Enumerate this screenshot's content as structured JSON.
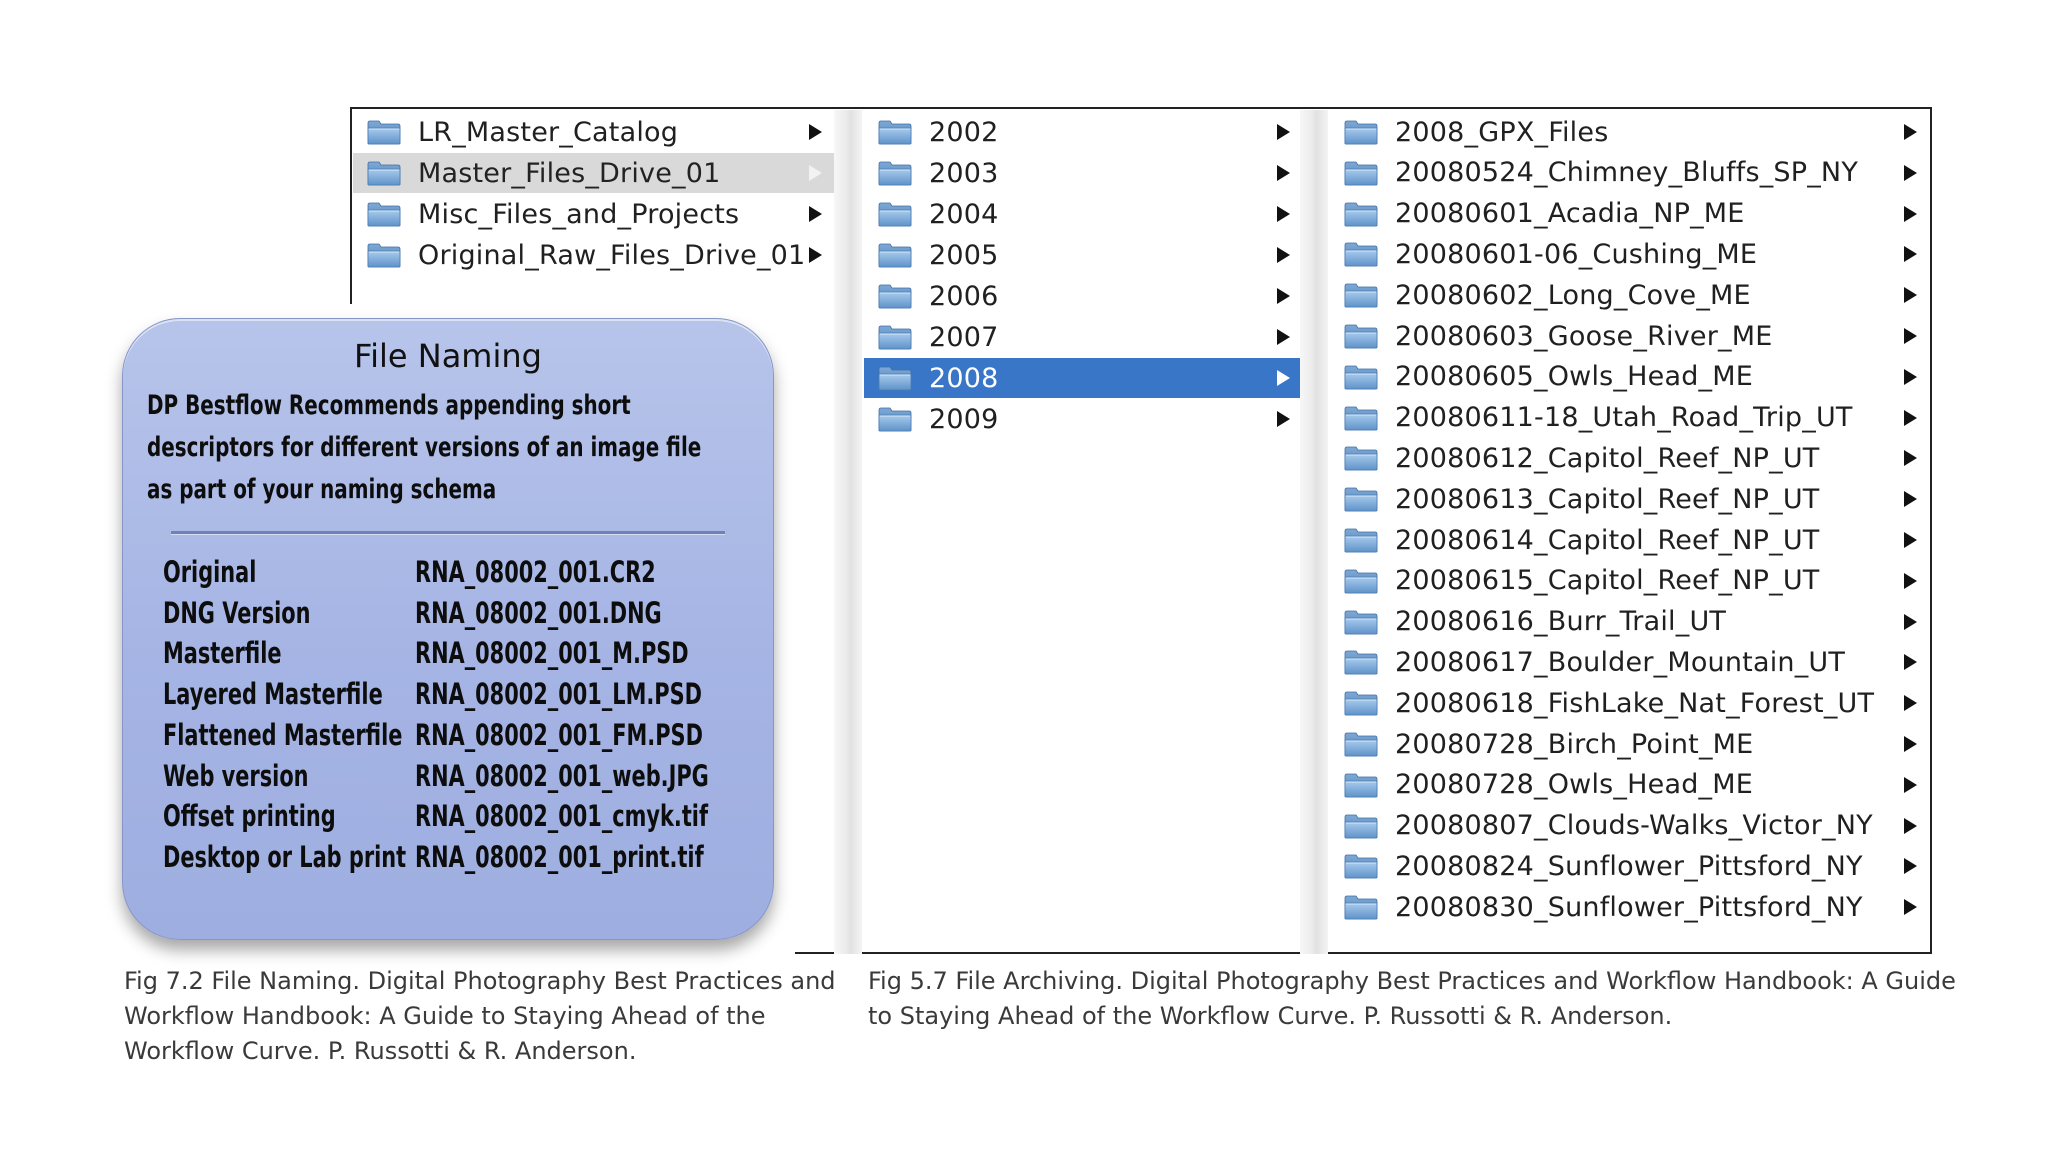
{
  "column1": {
    "items": [
      {
        "label": "LR_Master_Catalog",
        "state": "normal"
      },
      {
        "label": "Master_Files_Drive_01",
        "state": "inactive-selected"
      },
      {
        "label": "Misc_Files_and_Projects",
        "state": "normal"
      },
      {
        "label": "Original_Raw_Files_Drive_01",
        "state": "normal"
      }
    ]
  },
  "column2": {
    "items": [
      {
        "label": "2002",
        "state": "normal"
      },
      {
        "label": "2003",
        "state": "normal"
      },
      {
        "label": "2004",
        "state": "normal"
      },
      {
        "label": "2005",
        "state": "normal"
      },
      {
        "label": "2006",
        "state": "normal"
      },
      {
        "label": "2007",
        "state": "normal"
      },
      {
        "label": "2008",
        "state": "selected"
      },
      {
        "label": "2009",
        "state": "normal"
      }
    ]
  },
  "column3": {
    "items": [
      {
        "label": "2008_GPX_Files"
      },
      {
        "label": "20080524_Chimney_Bluffs_SP_NY"
      },
      {
        "label": "20080601_Acadia_NP_ME"
      },
      {
        "label": "20080601-06_Cushing_ME"
      },
      {
        "label": "20080602_Long_Cove_ME"
      },
      {
        "label": "20080603_Goose_River_ME"
      },
      {
        "label": "20080605_Owls_Head_ME"
      },
      {
        "label": "20080611-18_Utah_Road_Trip_UT"
      },
      {
        "label": "20080612_Capitol_Reef_NP_UT"
      },
      {
        "label": "20080613_Capitol_Reef_NP_UT"
      },
      {
        "label": "20080614_Capitol_Reef_NP_UT"
      },
      {
        "label": "20080615_Capitol_Reef_NP_UT"
      },
      {
        "label": "20080616_Burr_Trail_UT"
      },
      {
        "label": "20080617_Boulder_Mountain_UT"
      },
      {
        "label": "20080618_FishLake_Nat_Forest_UT"
      },
      {
        "label": "20080728_Birch_Point_ME"
      },
      {
        "label": "20080728_Owls_Head_ME"
      },
      {
        "label": "20080807_Clouds-Walks_Victor_NY"
      },
      {
        "label": "20080824_Sunflower_Pittsford_NY"
      },
      {
        "label": "20080830_Sunflower_Pittsford_NY"
      }
    ]
  },
  "naming_card": {
    "title": "File Naming",
    "description": "DP Bestflow Recommends appending short descriptors for different versions of an image file as part of your naming schema",
    "rows": [
      {
        "label": "Original",
        "value": "RNA_08002_001.CR2"
      },
      {
        "label": "DNG Version",
        "value": "RNA_08002_001.DNG"
      },
      {
        "label": "Masterfile",
        "value": "RNA_08002_001_M.PSD"
      },
      {
        "label": "Layered Masterfile",
        "value": "RNA_08002_001_LM.PSD"
      },
      {
        "label": "Flattened Masterfile",
        "value": "RNA_08002_001_FM.PSD"
      },
      {
        "label": "Web version",
        "value": "RNA_08002_001_web.JPG"
      },
      {
        "label": "Offset printing",
        "value": "RNA_08002_001_cmyk.tif"
      },
      {
        "label": "Desktop or Lab print",
        "value": "RNA_08002_001_print.tif"
      }
    ]
  },
  "captions": {
    "left": "Fig 7.2 File Naming. Digital Photography Best Practices and Workflow Handbook: A Guide to Staying Ahead of the Workflow Curve. P. Russotti & R. Anderson.",
    "right": "Fig 5.7 File Archiving. Digital Photography Best Practices and Workflow Handbook: A Guide to Staying Ahead of the Workflow Curve. P. Russotti & R. Anderson."
  },
  "colors": {
    "selection_blue": "#3a76c8",
    "inactive_selection_grey": "#d9d9d9",
    "folder_blue": "#7aa7d6",
    "card_blue": "#a5b4e4"
  },
  "icons": {
    "folder": "folder-icon",
    "disclosure": "disclosure-arrow-icon"
  }
}
